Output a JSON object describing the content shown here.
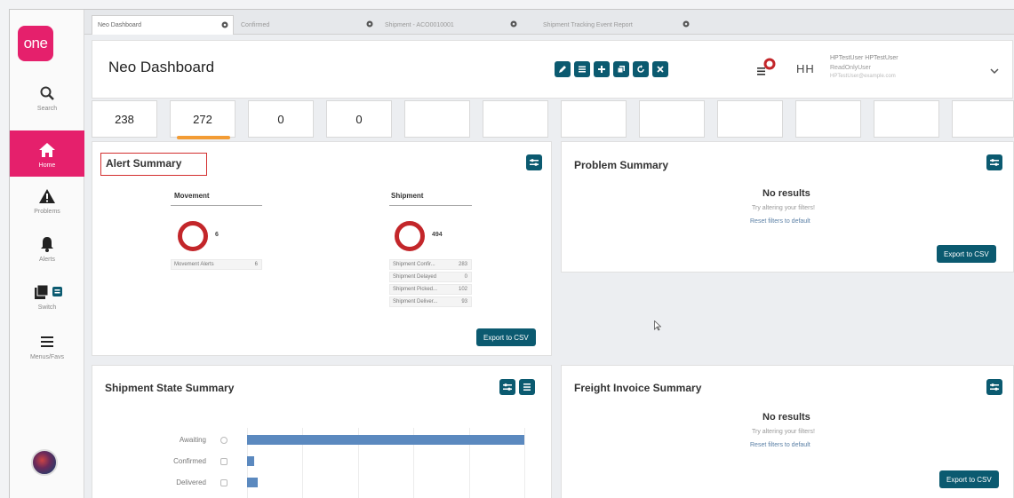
{
  "sidebar": {
    "logo": "one",
    "items": [
      {
        "label": "Search",
        "icon": "search-icon"
      },
      {
        "label": "Home",
        "icon": "home-icon"
      },
      {
        "label": "Problems",
        "icon": "warning-icon"
      },
      {
        "label": "Alerts",
        "icon": "bell-icon"
      },
      {
        "label": "Switch",
        "icon": "switch-icon"
      },
      {
        "label": "Menus/Favs",
        "icon": "menu-icon"
      }
    ]
  },
  "tabs": [
    {
      "label": "Neo Dashboard"
    },
    {
      "label": "Confirmed"
    },
    {
      "label": "Shipment - ACO0010001"
    },
    {
      "label": "Shipment Tracking Event Report"
    }
  ],
  "header": {
    "title": "Neo Dashboard",
    "initials": "HH",
    "user_name": "HPTestUser HPTestUser",
    "user_role": "ReadOnlyUser",
    "user_sub": "HPTestUser@example.com"
  },
  "kpis": [
    "238",
    "272",
    "0",
    "0",
    "",
    "",
    "",
    "",
    "",
    "",
    "",
    ""
  ],
  "alert_summary": {
    "title": "Alert Summary",
    "movement": {
      "heading": "Movement",
      "count": "6",
      "rows": [
        {
          "label": "Movement Alerts",
          "value": "6"
        }
      ]
    },
    "shipment": {
      "heading": "Shipment",
      "count": "494",
      "rows": [
        {
          "label": "Shipment Confir...",
          "value": "283"
        },
        {
          "label": "Shipment Delayed",
          "value": "0"
        },
        {
          "label": "Shipment Picked...",
          "value": "102"
        },
        {
          "label": "Shipment Deliver...",
          "value": "93"
        }
      ]
    },
    "export": "Export to CSV"
  },
  "problem_summary": {
    "title": "Problem Summary",
    "no_results": "No results",
    "hint": "Try altering your filters!",
    "reset": "Reset filters to default",
    "export": "Export to CSV"
  },
  "shipment_state_summary": {
    "title": "Shipment State Summary",
    "bars": [
      {
        "label": "Awaiting",
        "value": 100
      },
      {
        "label": "Confirmed",
        "value": 2.5
      },
      {
        "label": "Delivered",
        "value": 4
      }
    ]
  },
  "freight_invoice_summary": {
    "title": "Freight Invoice Summary",
    "no_results": "No results",
    "hint": "Try altering your filters!",
    "reset": "Reset filters to default",
    "export": "Export to CSV"
  },
  "colors": {
    "brand": "#e5206c",
    "accent": "#0b5a70",
    "alert": "#c3262a",
    "bar": "#5b89bf",
    "kpi_selected": "#f39c34"
  }
}
